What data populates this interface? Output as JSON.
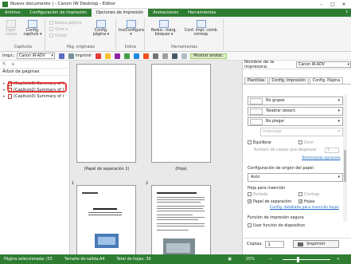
{
  "window": {
    "title": "Nuevo documento | - Canon iW Desktop - Editor",
    "controls": [
      "–",
      "□",
      "✕"
    ]
  },
  "ribbon_tabs": [
    "Archivo",
    "Configuración de impresión",
    "Opciones de impresión",
    "Anotaciones",
    "Herramientas"
  ],
  "active_tab": "Opciones de impresión",
  "ribbon": {
    "capitulos": {
      "label": "Capítulos",
      "btn1": "Capít. nuevo",
      "btn2": "Config. capítulo ▾"
    },
    "pag_originales": {
      "label": "Pág. originales",
      "small1": "Nueva página",
      "small2": "Girar ▾",
      "small3": "Dividir",
      "btn": "Config. página ▾"
    },
    "indice": {
      "label": "Índice",
      "btn": "Ins/Configura ▾"
    },
    "herramientas": {
      "label": "Herramientas",
      "btn1": "Reduc. márg. bloques ▾",
      "btn2": "Conf. impr. comb. corresp."
    }
  },
  "toolbar": {
    "printer_label": "Impr.:",
    "printer": "Canon iR-ADV",
    "print_btn": "Imprimir",
    "show_notes": "Mostrar anotac."
  },
  "left_pane": {
    "title": "Árbol de páginas",
    "items": [
      "(Capítulo1) Summary of I",
      "(Capítulo2) Summary of I",
      "(Capítulo3) Summary of I"
    ]
  },
  "pages": {
    "label1": "(Papel de separación 1)",
    "label2": "(Hoja)",
    "num1": "1",
    "num2": "2"
  },
  "right_pane": {
    "printer_label": "Nombre de la impresora:",
    "printer": "Canon iR-ADV",
    "tabs": [
      "Plantillas",
      "Config. Impresión",
      "Config. Página"
    ],
    "active_tab": "Config. Página",
    "dd_staple": "No grapar",
    "dd_punch": "Taladrar desact.",
    "dd_fold": "No plegar",
    "dd_insert": "Intercalar",
    "cb_equilibrar": "Equilibrar",
    "cb_girar": "Girar",
    "copies_label": "Número de copias que desplazar",
    "copies_value": "1",
    "link_finishing": "Terminando opciones",
    "paper_origin_label": "Configuración de origen del papel",
    "paper_origin": "Auto",
    "insert_sheet_label": "Hoja para inserción",
    "cb_portada": "Portada",
    "cb_contrap": "Contrap.",
    "cb_papel_sep": "Papel de separación",
    "cb_hojas": "Hojas",
    "link_insert": "Config. detallada para inserción hojas",
    "secure_label": "Función de impresión segura",
    "cb_user_func": "Usar función de dispositivo",
    "copies_row_label": "Copias:",
    "copies_row_value": "1",
    "print_button": "Imprimir"
  },
  "status": {
    "selected_pages": "Página seleccionada: /33",
    "output_size": "Tamaño de salida:A4",
    "total_sheets": "Total de hojas: 39",
    "zoom": "25%"
  },
  "colors": {
    "brand": "#2e7d32",
    "highlight": "#e53935"
  }
}
